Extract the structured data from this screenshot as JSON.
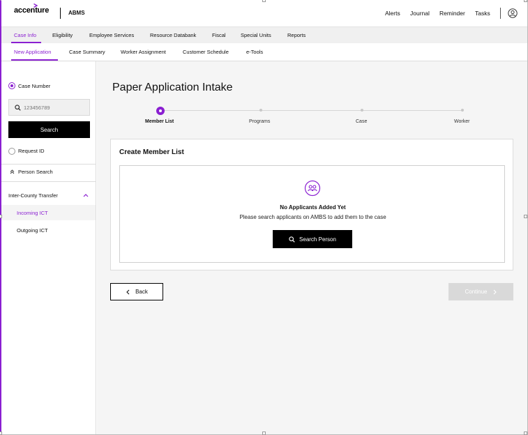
{
  "header": {
    "logo_text": "accenture",
    "app_name": "ABMS",
    "links": [
      "Alerts",
      "Journal",
      "Reminder",
      "Tasks"
    ]
  },
  "primary_nav": {
    "items": [
      "Case Info",
      "Eligibility",
      "Employee Services",
      "Resource Databank",
      "Fiscal",
      "Special Units",
      "Reports"
    ],
    "active": "Case Info"
  },
  "secondary_nav": {
    "items": [
      "New Application",
      "Case Summary",
      "Worker Assignment",
      "Customer Schedule",
      "e-Tools"
    ],
    "active": "New Application"
  },
  "sidebar": {
    "case_number_label": "Case Number",
    "case_number_placeholder": "123456789",
    "search_button": "Search",
    "request_id_label": "Request ID",
    "person_search_label": "Person Search",
    "ict_label": "Inter-County Transfer",
    "ict_items": [
      "Incoming ICT",
      "Outgoing ICT"
    ],
    "ict_active": "Incoming ICT"
  },
  "main": {
    "title": "Paper Application Intake",
    "steps": [
      "Member List",
      "Programs",
      "Case",
      "Worker"
    ],
    "active_step": "Member List",
    "card_title": "Create Member List",
    "empty_title": "No Applicants Added Yet",
    "empty_subtitle": "Please search applicants on AMBS to add them to the case",
    "search_person_button": "Search Person",
    "back_button": "Back",
    "continue_button": "Continue"
  },
  "colors": {
    "accent": "#8a1fd1",
    "primary_button": "#000000",
    "disabled_button": "#d9d9d9"
  }
}
